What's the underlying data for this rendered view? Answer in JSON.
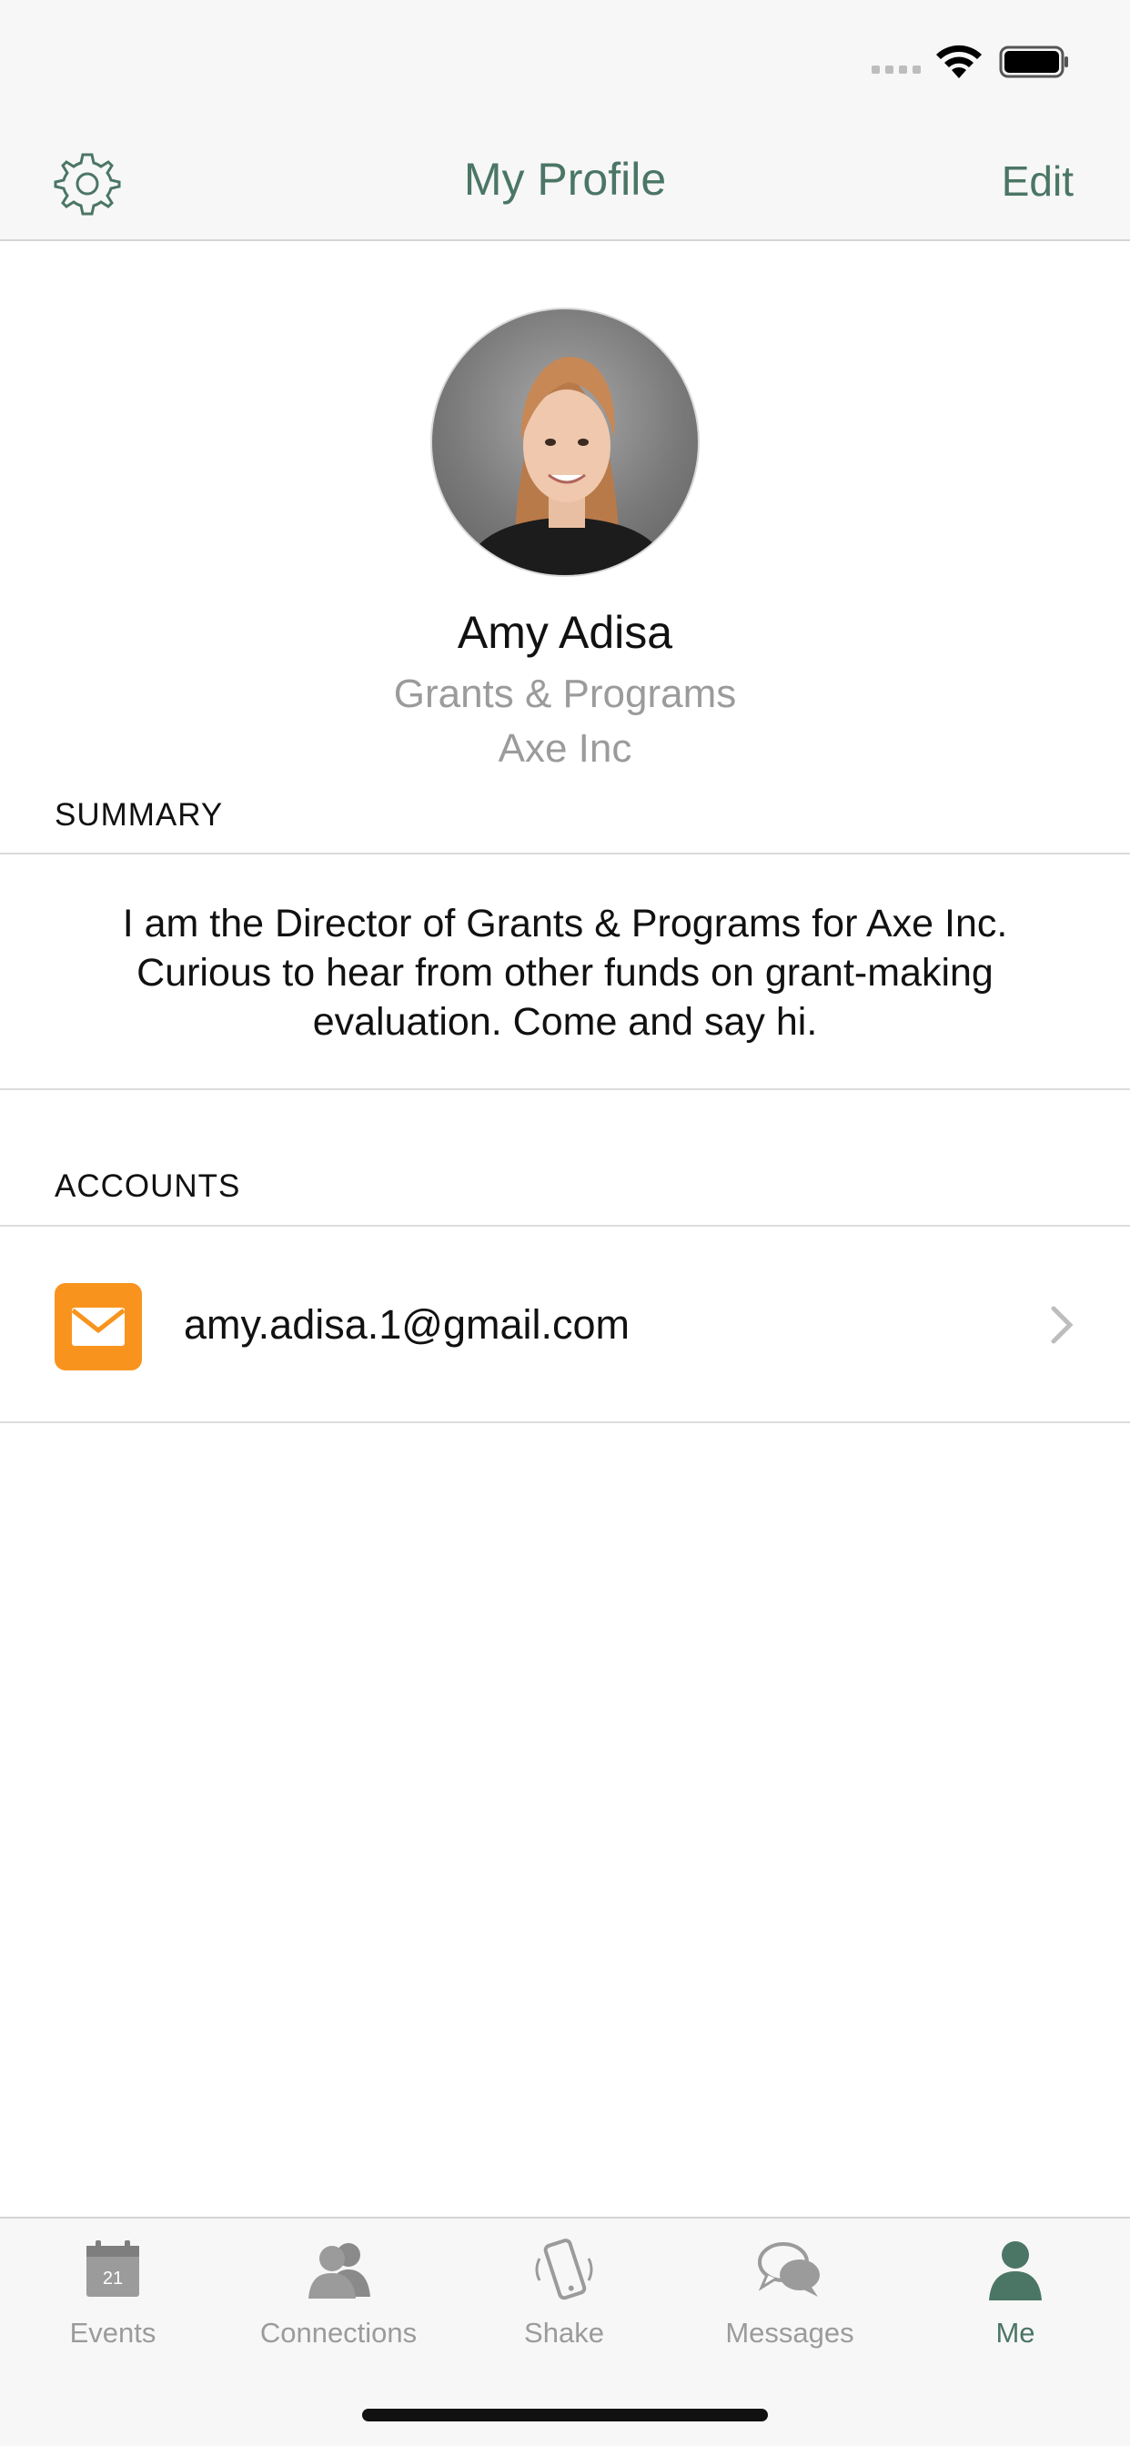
{
  "nav": {
    "title": "My Profile",
    "edit_label": "Edit"
  },
  "profile": {
    "name": "Amy Adisa",
    "role": "Grants & Programs",
    "company": "Axe Inc"
  },
  "summary": {
    "header": "SUMMARY",
    "text": "I am the Director of Grants & Programs for Axe Inc. Curious to hear from other funds on grant-making evaluation. Come and say hi."
  },
  "accounts": {
    "header": "ACCOUNTS",
    "items": [
      {
        "email": "amy.adisa.1@gmail.com",
        "icon": "mail-icon"
      }
    ]
  },
  "tabs": [
    {
      "label": "Events",
      "icon": "calendar-icon",
      "calendar_day": "21",
      "active": false
    },
    {
      "label": "Connections",
      "icon": "people-icon",
      "active": false
    },
    {
      "label": "Shake",
      "icon": "phone-shake-icon",
      "active": false
    },
    {
      "label": "Messages",
      "icon": "chat-bubbles-icon",
      "active": false
    },
    {
      "label": "Me",
      "icon": "person-icon",
      "active": true
    }
  ],
  "colors": {
    "accent": "#4b7665",
    "mail_icon_bg": "#f8941d",
    "inactive_tab": "#9b9b9b",
    "secondary_text": "#9b9b9b"
  }
}
